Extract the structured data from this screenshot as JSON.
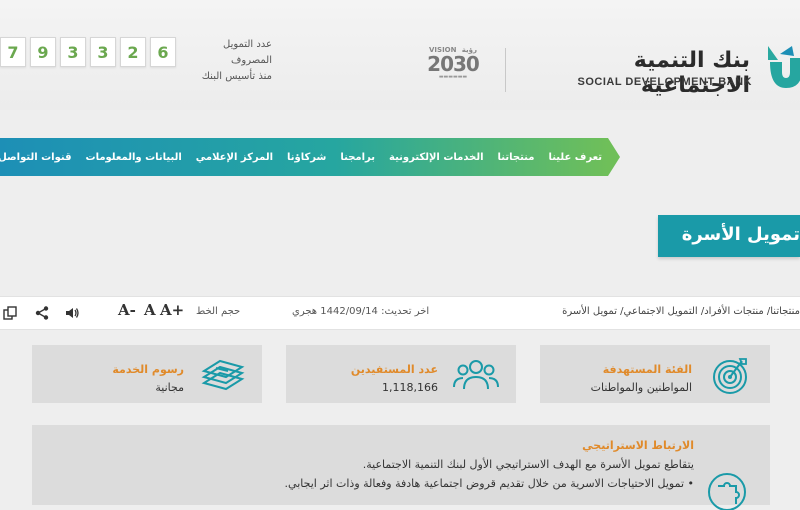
{
  "counter": {
    "digits": [
      "6",
      "2",
      "3",
      "3",
      "9",
      "7"
    ],
    "label_line1": "عدد التمويل المصروف",
    "label_line2": "منذ تأسيس البنك"
  },
  "vision": {
    "top_left": "VISION",
    "top_right": "رؤية",
    "year": "2030"
  },
  "bank": {
    "name_ar": "بنك التنمية الاجتماعية",
    "name_en": "SOCIAL DEVELOPMENT BANK"
  },
  "nav": {
    "items": [
      "تعرف علينا",
      "منتجاتنا",
      "الخدمات الإلكترونية",
      "برامجنا",
      "شركاؤنا",
      "المركز الإعلامي",
      "البيانات والمعلومات",
      "قنوات التواصل"
    ]
  },
  "page_title": "تمويل الأسرة",
  "toolbar": {
    "breadcrumb": "منتجاتنا/ منتجات الأفراد/ التمويل الاجتماعي/ تمويل الأسرة",
    "updated": "اخر تحديث: 1442/09/14 هجري",
    "font_label": "حجم الخط",
    "font_plus": "A+",
    "font_normal": "A",
    "font_minus": "A-"
  },
  "cards": {
    "target": {
      "title": "الفئة المستهدفة",
      "value": "المواطنين والمواطنات",
      "icon": "target-icon"
    },
    "beneficiaries": {
      "title": "عدد المستفيدين",
      "value": "1,118,166",
      "icon": "people-icon"
    },
    "fees": {
      "title": "رسوم الخدمة",
      "value": "مجانية",
      "icon": "money-stack-icon"
    }
  },
  "strategic": {
    "title": "الارتباط الاستراتيجي",
    "line1": "يتقاطع تمويل الأسرة مع الهدف الاستراتيجي الأول لبنك التنمية الاجتماعية.",
    "line2": "• تمويل الاحتياجات الاسرية من خلال تقديم قروض اجتماعية هادفة وفعالة وذات اثر ايجابي."
  },
  "colors": {
    "accent_orange": "#e08a2a",
    "teal": "#1a9aa8",
    "green": "#6fbf59"
  }
}
